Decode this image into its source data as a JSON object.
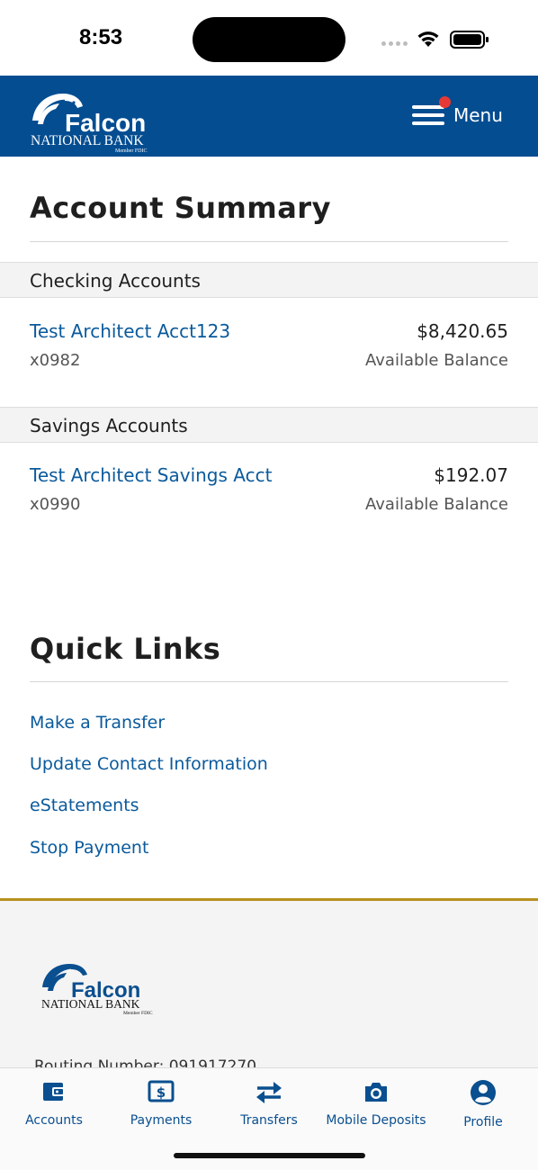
{
  "status_bar": {
    "time": "8:53"
  },
  "header": {
    "logo_name": "Falcon",
    "logo_subtitle": "NATIONAL BANK",
    "logo_member": "Member FDIC",
    "menu_label": "Menu",
    "menu_notification": true,
    "brand_color": "#044d91"
  },
  "account_summary": {
    "title": "Account Summary",
    "sections": [
      {
        "header": "Checking Accounts",
        "accounts": [
          {
            "name": "Test Architect Acct123",
            "number": "x0982",
            "balance": "$8,420.65",
            "balance_label": "Available Balance"
          }
        ]
      },
      {
        "header": "Savings Accounts",
        "accounts": [
          {
            "name": "Test Architect Savings Acct",
            "number": "x0990",
            "balance": "$192.07",
            "balance_label": "Available Balance"
          }
        ]
      }
    ]
  },
  "quick_links": {
    "title": "Quick Links",
    "items": [
      "Make a Transfer",
      "Update Contact Information",
      "eStatements",
      "Stop Payment"
    ]
  },
  "footer": {
    "routing": "Routing Number: 091917270",
    "accent_color": "#b8901e"
  },
  "tab_bar": {
    "tabs": [
      {
        "label": "Accounts",
        "icon": "wallet-icon"
      },
      {
        "label": "Payments",
        "icon": "dollar-bill-icon"
      },
      {
        "label": "Transfers",
        "icon": "transfer-arrows-icon"
      },
      {
        "label": "Mobile Deposits",
        "icon": "camera-icon"
      },
      {
        "label": "Profile",
        "icon": "user-circle-icon"
      }
    ]
  }
}
